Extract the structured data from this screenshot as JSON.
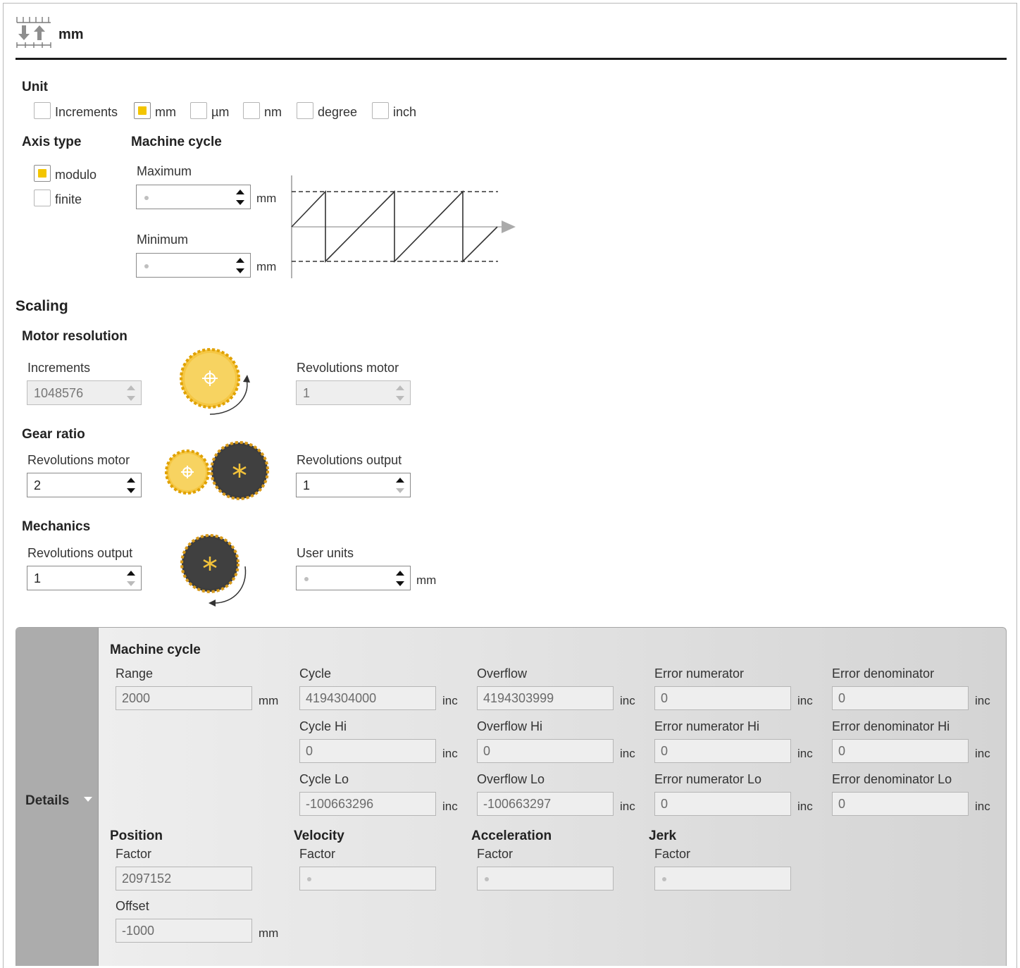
{
  "header": {
    "title": "mm",
    "icon": "scaling-arrows-icon"
  },
  "unit": {
    "title": "Unit",
    "options": [
      {
        "label": "Increments",
        "checked": false
      },
      {
        "label": "mm",
        "checked": true
      },
      {
        "label": "µm",
        "checked": false
      },
      {
        "label": "nm",
        "checked": false
      },
      {
        "label": "degree",
        "checked": false
      },
      {
        "label": "inch",
        "checked": false
      }
    ]
  },
  "axis_type": {
    "title": "Axis type",
    "options": [
      {
        "label": "modulo",
        "checked": true
      },
      {
        "label": "finite",
        "checked": false
      }
    ]
  },
  "machine_cycle": {
    "title": "Machine cycle",
    "maximum_label": "Maximum",
    "maximum_value": "",
    "minimum_label": "Minimum",
    "minimum_value": "",
    "unit": "mm"
  },
  "scaling": {
    "title": "Scaling",
    "motor_resolution": {
      "title": "Motor resolution",
      "increments_label": "Increments",
      "increments_value": "1048576",
      "revolutions_motor_label": "Revolutions motor",
      "revolutions_motor_value": "1"
    },
    "gear_ratio": {
      "title": "Gear ratio",
      "revolutions_motor_label": "Revolutions motor",
      "revolutions_motor_value": "2",
      "revolutions_output_label": "Revolutions output",
      "revolutions_output_value": "1"
    },
    "mechanics": {
      "title": "Mechanics",
      "revolutions_output_label": "Revolutions output",
      "revolutions_output_value": "1",
      "user_units_label": "User units",
      "user_units_value": "",
      "unit": "mm"
    }
  },
  "details": {
    "side_label": "Details",
    "machine_cycle_title": "Machine cycle",
    "range": {
      "label": "Range",
      "value": "2000",
      "unit": "mm"
    },
    "cycle": {
      "label": "Cycle",
      "value": "4194304000",
      "unit": "inc"
    },
    "overflow": {
      "label": "Overflow",
      "value": "4194303999",
      "unit": "inc"
    },
    "error_numerator": {
      "label": "Error numerator",
      "value": "0",
      "unit": "inc"
    },
    "error_denominator": {
      "label": "Error denominator",
      "value": "0",
      "unit": "inc"
    },
    "cycle_hi": {
      "label": "Cycle Hi",
      "value": "0",
      "unit": "inc"
    },
    "overflow_hi": {
      "label": "Overflow Hi",
      "value": "0",
      "unit": "inc"
    },
    "error_numerator_hi": {
      "label": "Error numerator Hi",
      "value": "0",
      "unit": "inc"
    },
    "error_denominator_hi": {
      "label": "Error denominator Hi",
      "value": "0",
      "unit": "inc"
    },
    "cycle_lo": {
      "label": "Cycle Lo",
      "value": "-100663296",
      "unit": "inc"
    },
    "overflow_lo": {
      "label": "Overflow Lo",
      "value": "-100663297",
      "unit": "inc"
    },
    "error_numerator_lo": {
      "label": "Error numerator Lo",
      "value": "0",
      "unit": "inc"
    },
    "error_denominator_lo": {
      "label": "Error denominator Lo",
      "value": "0",
      "unit": "inc"
    },
    "position": {
      "title": "Position",
      "factor_label": "Factor",
      "factor_value": "2097152",
      "offset_label": "Offset",
      "offset_value": "-1000",
      "offset_unit": "mm"
    },
    "velocity": {
      "title": "Velocity",
      "factor_label": "Factor",
      "factor_value": ""
    },
    "acceleration": {
      "title": "Acceleration",
      "factor_label": "Factor",
      "factor_value": ""
    },
    "jerk": {
      "title": "Jerk",
      "factor_label": "Factor",
      "factor_value": ""
    }
  }
}
